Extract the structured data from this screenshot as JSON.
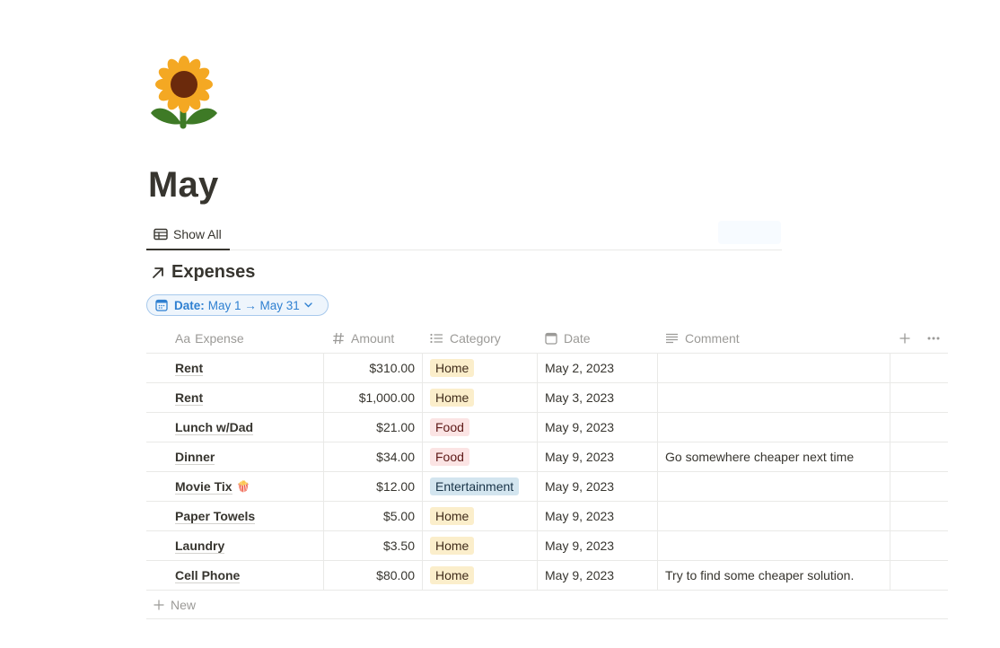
{
  "page": {
    "icon": "sunflower-icon",
    "title": "May"
  },
  "views": {
    "tabs": [
      {
        "label": "Show All",
        "icon": "table-icon",
        "active": true
      }
    ]
  },
  "database": {
    "title": "Expenses",
    "link_icon": "arrow-up-right-icon",
    "filter": {
      "label": "Date:",
      "value": "May 1 → May 31"
    },
    "columns": {
      "expense": {
        "prefix": "Aa",
        "label": "Expense"
      },
      "amount": {
        "label": "Amount",
        "icon": "hash-icon"
      },
      "category": {
        "label": "Category",
        "icon": "list-icon"
      },
      "date": {
        "label": "Date",
        "icon": "calendar-icon"
      },
      "comment": {
        "label": "Comment",
        "icon": "text-icon"
      }
    },
    "tag_colors": {
      "Home": {
        "bg": "#fbeecb",
        "fg": "#402c1b"
      },
      "Food": {
        "bg": "#fbe4e4",
        "fg": "#5d1715"
      },
      "Entertainment": {
        "bg": "#d3e5ef",
        "fg": "#183347"
      }
    },
    "rows": [
      {
        "expense": "Rent",
        "amount": "$310.00",
        "category": "Home",
        "date": "May 2, 2023",
        "comment": ""
      },
      {
        "expense": "Rent",
        "amount": "$1,000.00",
        "category": "Home",
        "date": "May 3, 2023",
        "comment": ""
      },
      {
        "expense": "Lunch w/Dad",
        "amount": "$21.00",
        "category": "Food",
        "date": "May 9, 2023",
        "comment": ""
      },
      {
        "expense": "Dinner",
        "amount": "$34.00",
        "category": "Food",
        "date": "May 9, 2023",
        "comment": "Go somewhere cheaper next time"
      },
      {
        "expense": "Movie Tix",
        "emoji": "🍿",
        "amount": "$12.00",
        "category": "Entertainment",
        "date": "May 9, 2023",
        "comment": ""
      },
      {
        "expense": "Paper Towels",
        "amount": "$5.00",
        "category": "Home",
        "date": "May 9, 2023",
        "comment": ""
      },
      {
        "expense": "Laundry",
        "amount": "$3.50",
        "category": "Home",
        "date": "May 9, 2023",
        "comment": ""
      },
      {
        "expense": "Cell Phone",
        "amount": "$80.00",
        "category": "Home",
        "date": "May 9, 2023",
        "comment": "Try to find some cheaper solution."
      }
    ],
    "new_label": "New"
  }
}
